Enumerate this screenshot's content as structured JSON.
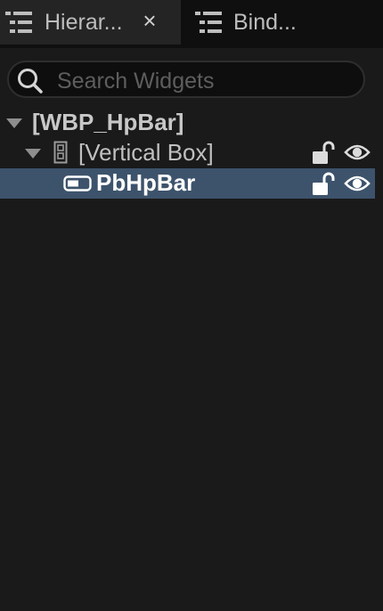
{
  "tabs": [
    {
      "label": "Hierar...",
      "active": true,
      "icon": "hierarchy-icon",
      "close": "×"
    },
    {
      "label": "Bind...",
      "active": false,
      "icon": "bindings-icon"
    }
  ],
  "search": {
    "placeholder": "Search Widgets",
    "value": "",
    "icon": "search-icon"
  },
  "tree": {
    "root": {
      "label": "[WBP_HpBar]",
      "expanded": true
    },
    "vertical_box": {
      "label": "[Vertical Box]",
      "expanded": true,
      "icon": "vertical-box-icon"
    },
    "progress_bar": {
      "label": "PbHpBar",
      "selected": true,
      "icon": "progress-bar-icon"
    }
  },
  "colors": {
    "background": "#1a1a1a",
    "tabbar": "#0f0f0f",
    "active_tab": "#242424",
    "selection": "#3d536b"
  }
}
